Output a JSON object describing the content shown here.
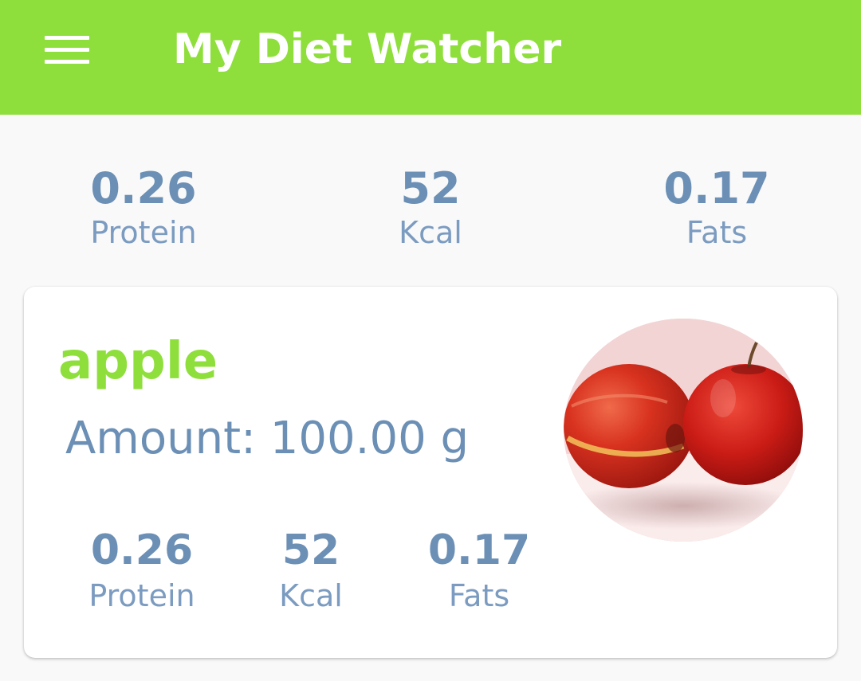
{
  "appbar": {
    "title": "My Diet Watcher",
    "menu_icon": "hamburger-menu-icon",
    "background_color": "#8fdf3c"
  },
  "summary": {
    "protein": {
      "value": "0.26",
      "label": "Protein"
    },
    "kcal": {
      "value": "52",
      "label": "Kcal"
    },
    "fats": {
      "value": "0.17",
      "label": "Fats"
    }
  },
  "food_item": {
    "name": "apple",
    "amount_label": "Amount:",
    "amount_value": "100.00 g",
    "image_icon": "apple-photo",
    "protein": {
      "value": "0.26",
      "label": "Protein"
    },
    "kcal": {
      "value": "52",
      "label": "Kcal"
    },
    "fats": {
      "value": "0.17",
      "label": "Fats"
    }
  },
  "colors": {
    "accent_green": "#8fdf3c",
    "text_blue": "#6b8fb5",
    "label_blue": "#7b9bc0"
  }
}
